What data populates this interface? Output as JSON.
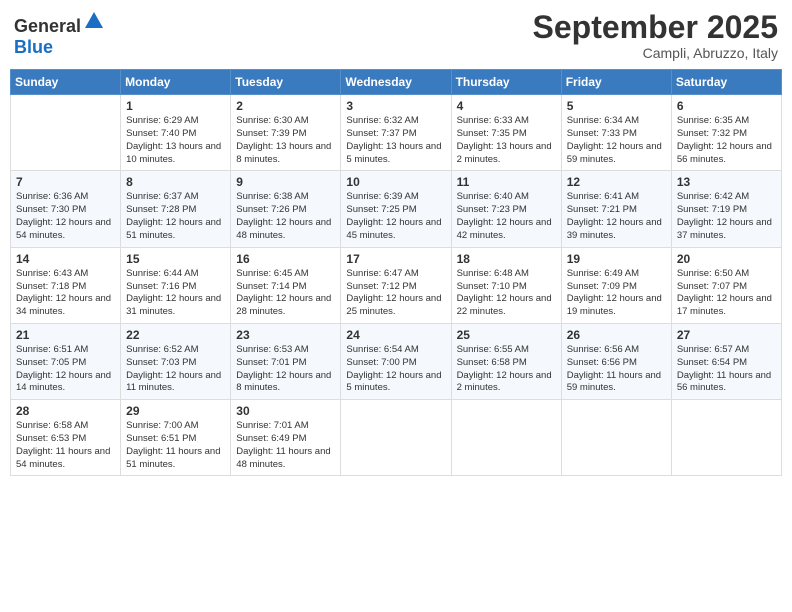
{
  "header": {
    "logo_general": "General",
    "logo_blue": "Blue",
    "month": "September 2025",
    "location": "Campli, Abruzzo, Italy"
  },
  "days_of_week": [
    "Sunday",
    "Monday",
    "Tuesday",
    "Wednesday",
    "Thursday",
    "Friday",
    "Saturday"
  ],
  "weeks": [
    [
      {
        "day": "",
        "info": ""
      },
      {
        "day": "1",
        "info": "Sunrise: 6:29 AM\nSunset: 7:40 PM\nDaylight: 13 hours\nand 10 minutes."
      },
      {
        "day": "2",
        "info": "Sunrise: 6:30 AM\nSunset: 7:39 PM\nDaylight: 13 hours\nand 8 minutes."
      },
      {
        "day": "3",
        "info": "Sunrise: 6:32 AM\nSunset: 7:37 PM\nDaylight: 13 hours\nand 5 minutes."
      },
      {
        "day": "4",
        "info": "Sunrise: 6:33 AM\nSunset: 7:35 PM\nDaylight: 13 hours\nand 2 minutes."
      },
      {
        "day": "5",
        "info": "Sunrise: 6:34 AM\nSunset: 7:33 PM\nDaylight: 12 hours\nand 59 minutes."
      },
      {
        "day": "6",
        "info": "Sunrise: 6:35 AM\nSunset: 7:32 PM\nDaylight: 12 hours\nand 56 minutes."
      }
    ],
    [
      {
        "day": "7",
        "info": "Sunrise: 6:36 AM\nSunset: 7:30 PM\nDaylight: 12 hours\nand 54 minutes."
      },
      {
        "day": "8",
        "info": "Sunrise: 6:37 AM\nSunset: 7:28 PM\nDaylight: 12 hours\nand 51 minutes."
      },
      {
        "day": "9",
        "info": "Sunrise: 6:38 AM\nSunset: 7:26 PM\nDaylight: 12 hours\nand 48 minutes."
      },
      {
        "day": "10",
        "info": "Sunrise: 6:39 AM\nSunset: 7:25 PM\nDaylight: 12 hours\nand 45 minutes."
      },
      {
        "day": "11",
        "info": "Sunrise: 6:40 AM\nSunset: 7:23 PM\nDaylight: 12 hours\nand 42 minutes."
      },
      {
        "day": "12",
        "info": "Sunrise: 6:41 AM\nSunset: 7:21 PM\nDaylight: 12 hours\nand 39 minutes."
      },
      {
        "day": "13",
        "info": "Sunrise: 6:42 AM\nSunset: 7:19 PM\nDaylight: 12 hours\nand 37 minutes."
      }
    ],
    [
      {
        "day": "14",
        "info": "Sunrise: 6:43 AM\nSunset: 7:18 PM\nDaylight: 12 hours\nand 34 minutes."
      },
      {
        "day": "15",
        "info": "Sunrise: 6:44 AM\nSunset: 7:16 PM\nDaylight: 12 hours\nand 31 minutes."
      },
      {
        "day": "16",
        "info": "Sunrise: 6:45 AM\nSunset: 7:14 PM\nDaylight: 12 hours\nand 28 minutes."
      },
      {
        "day": "17",
        "info": "Sunrise: 6:47 AM\nSunset: 7:12 PM\nDaylight: 12 hours\nand 25 minutes."
      },
      {
        "day": "18",
        "info": "Sunrise: 6:48 AM\nSunset: 7:10 PM\nDaylight: 12 hours\nand 22 minutes."
      },
      {
        "day": "19",
        "info": "Sunrise: 6:49 AM\nSunset: 7:09 PM\nDaylight: 12 hours\nand 19 minutes."
      },
      {
        "day": "20",
        "info": "Sunrise: 6:50 AM\nSunset: 7:07 PM\nDaylight: 12 hours\nand 17 minutes."
      }
    ],
    [
      {
        "day": "21",
        "info": "Sunrise: 6:51 AM\nSunset: 7:05 PM\nDaylight: 12 hours\nand 14 minutes."
      },
      {
        "day": "22",
        "info": "Sunrise: 6:52 AM\nSunset: 7:03 PM\nDaylight: 12 hours\nand 11 minutes."
      },
      {
        "day": "23",
        "info": "Sunrise: 6:53 AM\nSunset: 7:01 PM\nDaylight: 12 hours\nand 8 minutes."
      },
      {
        "day": "24",
        "info": "Sunrise: 6:54 AM\nSunset: 7:00 PM\nDaylight: 12 hours\nand 5 minutes."
      },
      {
        "day": "25",
        "info": "Sunrise: 6:55 AM\nSunset: 6:58 PM\nDaylight: 12 hours\nand 2 minutes."
      },
      {
        "day": "26",
        "info": "Sunrise: 6:56 AM\nSunset: 6:56 PM\nDaylight: 11 hours\nand 59 minutes."
      },
      {
        "day": "27",
        "info": "Sunrise: 6:57 AM\nSunset: 6:54 PM\nDaylight: 11 hours\nand 56 minutes."
      }
    ],
    [
      {
        "day": "28",
        "info": "Sunrise: 6:58 AM\nSunset: 6:53 PM\nDaylight: 11 hours\nand 54 minutes."
      },
      {
        "day": "29",
        "info": "Sunrise: 7:00 AM\nSunset: 6:51 PM\nDaylight: 11 hours\nand 51 minutes."
      },
      {
        "day": "30",
        "info": "Sunrise: 7:01 AM\nSunset: 6:49 PM\nDaylight: 11 hours\nand 48 minutes."
      },
      {
        "day": "",
        "info": ""
      },
      {
        "day": "",
        "info": ""
      },
      {
        "day": "",
        "info": ""
      },
      {
        "day": "",
        "info": ""
      }
    ]
  ]
}
